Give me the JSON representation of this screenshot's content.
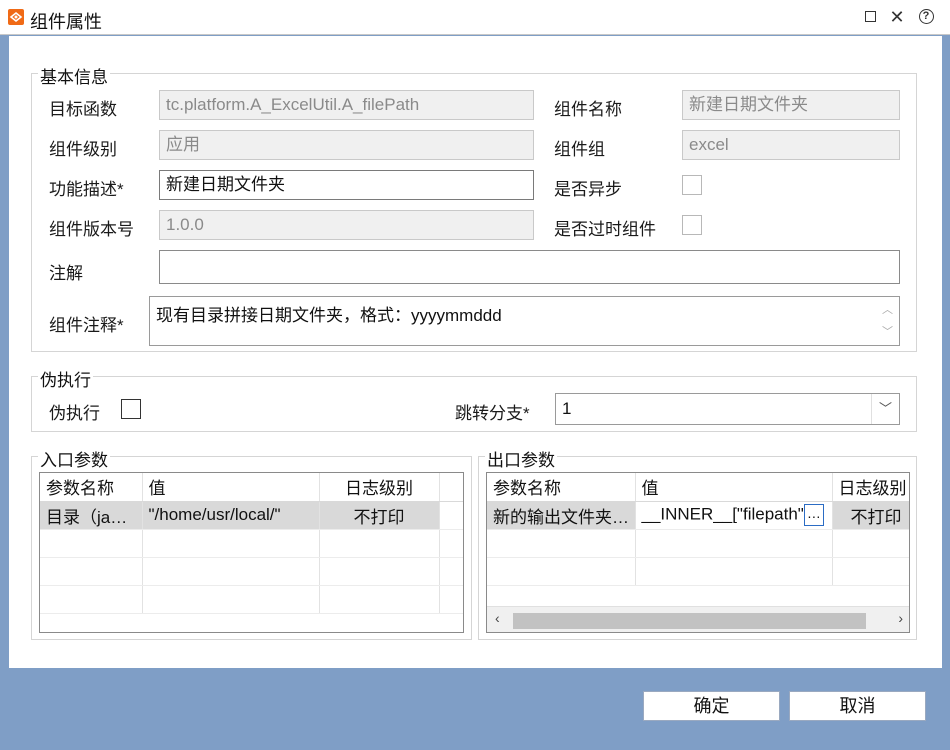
{
  "window": {
    "title": "组件属性",
    "maximize_icon": "maximize-icon",
    "close_glyph": "✕",
    "help_glyph": "?"
  },
  "basic": {
    "legend": "基本信息",
    "target_func_label": "目标函数",
    "target_func_value": "tc.platform.A_ExcelUtil.A_filePath",
    "comp_name_label": "组件名称",
    "comp_name_value": "新建日期文件夹",
    "comp_level_label": "组件级别",
    "comp_level_value": "应用",
    "comp_group_label": "组件组",
    "comp_group_value": "excel",
    "func_desc_label": "功能描述*",
    "func_desc_value": "新建日期文件夹",
    "async_label": "是否异步",
    "version_label": "组件版本号",
    "version_value": "1.0.0",
    "deprecated_label": "是否过时组件",
    "annotation_label": "注解",
    "annotation_value": "",
    "comp_comment_label": "组件注释*",
    "comp_comment_value": "现有目录拼接日期文件夹，格式：yyyymmddd"
  },
  "pseudo": {
    "legend": "伪执行",
    "pseudo_label": "伪执行",
    "branch_label": "跳转分支*",
    "branch_value": "1"
  },
  "input_params": {
    "legend": "入口参数",
    "columns": [
      "参数名称",
      "值",
      "日志级别"
    ],
    "rows": [
      [
        "目录（ja…",
        "\"/home/usr/local/\"",
        "不打印"
      ]
    ]
  },
  "output_params": {
    "legend": "出口参数",
    "columns": [
      "参数名称",
      "值",
      "日志级别"
    ],
    "rows": [
      [
        "新的输出文件夹…",
        "__INNER__[\"filepath\"",
        "不打印"
      ]
    ],
    "ellipsis": "…",
    "scroll_left": "‹",
    "scroll_right": "›"
  },
  "buttons": {
    "ok": "确定",
    "cancel": "取消"
  },
  "colors": {
    "accent": "#f06a16",
    "frame": "#7f9ec6",
    "selection": "#2b6cc4"
  }
}
